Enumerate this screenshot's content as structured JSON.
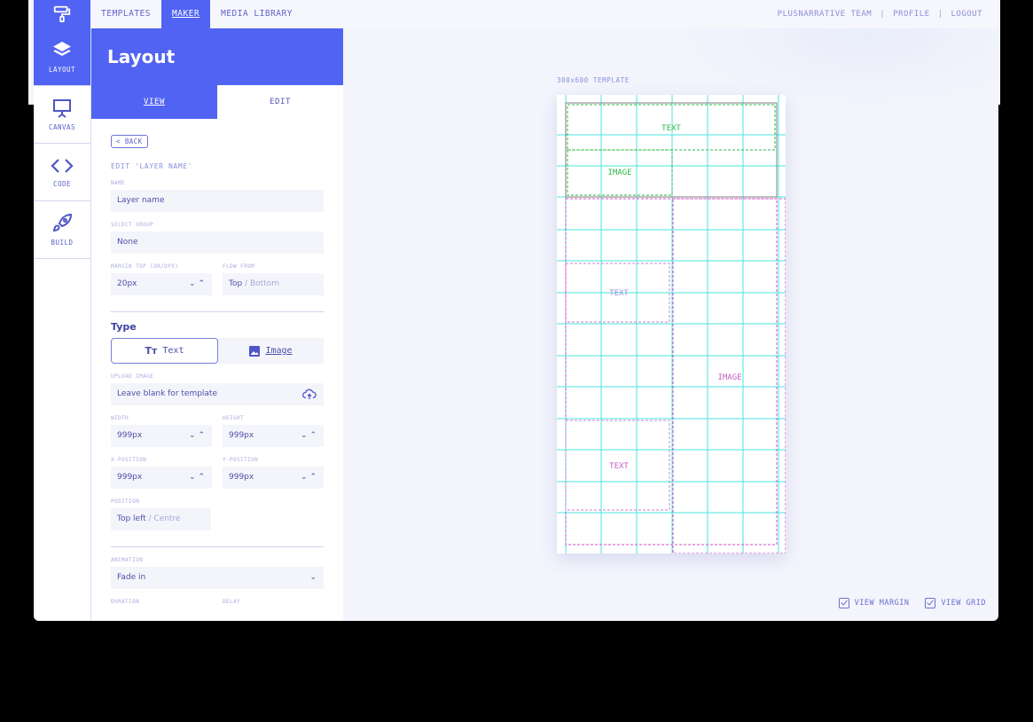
{
  "topnav": {
    "items": [
      {
        "label": "TEMPLATES",
        "active": false
      },
      {
        "label": "MAKER",
        "active": true
      },
      {
        "label": "MEDIA LIBRARY",
        "active": false
      }
    ],
    "team": "PLUSNARRATIVE TEAM",
    "profile": "PROFILE",
    "logout": "LOGOUT",
    "separator": "|"
  },
  "sidebar": {
    "items": [
      {
        "label": "LAYOUT",
        "icon": "layers-icon",
        "active": true
      },
      {
        "label": "CANVAS",
        "icon": "easel-icon",
        "active": false
      },
      {
        "label": "CODE",
        "icon": "code-icon",
        "active": false
      },
      {
        "label": "BUILD",
        "icon": "rocket-icon",
        "active": false
      }
    ]
  },
  "panel": {
    "title": "Layout",
    "tabs": {
      "view": "VIEW",
      "edit": "EDIT"
    },
    "back": "< BACK",
    "edit_title": "EDIT 'LAYER NAME'",
    "name": {
      "label": "NAME",
      "value": "Layer name"
    },
    "group": {
      "label": "SELECT GROUP",
      "value": "None"
    },
    "margin_top": {
      "label": "MARGIN TOP (OR/DPX)",
      "value": "20px"
    },
    "flow_from": {
      "label": "FLOW FROM",
      "value": "Top",
      "alt": "Bottom",
      "sep": "/"
    },
    "type_heading": "Type",
    "type_text": "Text",
    "type_image": "Image",
    "upload": {
      "label": "UPLOAD IMAGE",
      "value": "Leave blank for template"
    },
    "width": {
      "label": "WIDTH",
      "value": "999px"
    },
    "height": {
      "label": "HEIGHT",
      "value": "999px"
    },
    "xpos": {
      "label": "X-POSITION",
      "value": "999px"
    },
    "ypos": {
      "label": "Y-POSITION",
      "value": "999px"
    },
    "position": {
      "label": "POSITION",
      "value": "Top left",
      "alt": "Centre",
      "sep": "/"
    },
    "animation": {
      "label": "ANIMATION",
      "value": "Fade in"
    },
    "duration": {
      "label": "DURATION"
    },
    "delay": {
      "label": "DELAY"
    }
  },
  "canvas": {
    "template_label": "300x600 TEMPLATE",
    "boxes": {
      "text1": "TEXT",
      "image1": "IMAGE",
      "text2": "TEXT",
      "image2": "IMAGE",
      "text3": "TEXT"
    },
    "view_margin": "VIEW MARGIN",
    "view_grid": "VIEW GRID"
  },
  "colors": {
    "accent": "#5163f2",
    "grid": "#48e6dc",
    "green": "#2fb84a",
    "magenta": "#d24fc9"
  }
}
